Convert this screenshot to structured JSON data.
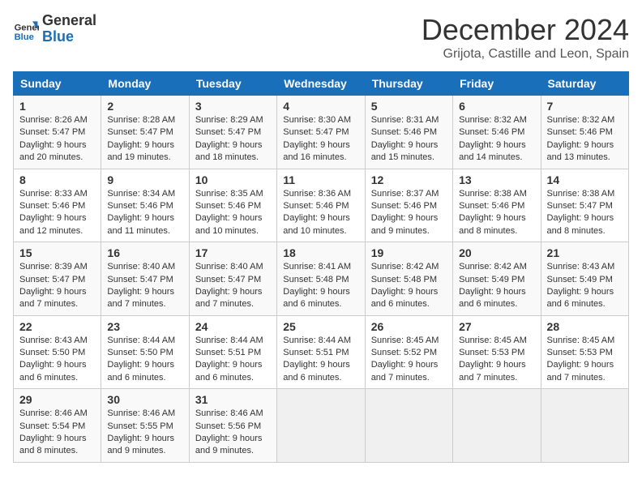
{
  "header": {
    "logo_general": "General",
    "logo_blue": "Blue",
    "month": "December 2024",
    "location": "Grijota, Castille and Leon, Spain"
  },
  "days_of_week": [
    "Sunday",
    "Monday",
    "Tuesday",
    "Wednesday",
    "Thursday",
    "Friday",
    "Saturday"
  ],
  "weeks": [
    [
      {
        "day": 1,
        "lines": [
          "Sunrise: 8:26 AM",
          "Sunset: 5:47 PM",
          "Daylight: 9 hours",
          "and 20 minutes."
        ]
      },
      {
        "day": 2,
        "lines": [
          "Sunrise: 8:28 AM",
          "Sunset: 5:47 PM",
          "Daylight: 9 hours",
          "and 19 minutes."
        ]
      },
      {
        "day": 3,
        "lines": [
          "Sunrise: 8:29 AM",
          "Sunset: 5:47 PM",
          "Daylight: 9 hours",
          "and 18 minutes."
        ]
      },
      {
        "day": 4,
        "lines": [
          "Sunrise: 8:30 AM",
          "Sunset: 5:47 PM",
          "Daylight: 9 hours",
          "and 16 minutes."
        ]
      },
      {
        "day": 5,
        "lines": [
          "Sunrise: 8:31 AM",
          "Sunset: 5:46 PM",
          "Daylight: 9 hours",
          "and 15 minutes."
        ]
      },
      {
        "day": 6,
        "lines": [
          "Sunrise: 8:32 AM",
          "Sunset: 5:46 PM",
          "Daylight: 9 hours",
          "and 14 minutes."
        ]
      },
      {
        "day": 7,
        "lines": [
          "Sunrise: 8:32 AM",
          "Sunset: 5:46 PM",
          "Daylight: 9 hours",
          "and 13 minutes."
        ]
      }
    ],
    [
      {
        "day": 8,
        "lines": [
          "Sunrise: 8:33 AM",
          "Sunset: 5:46 PM",
          "Daylight: 9 hours",
          "and 12 minutes."
        ]
      },
      {
        "day": 9,
        "lines": [
          "Sunrise: 8:34 AM",
          "Sunset: 5:46 PM",
          "Daylight: 9 hours",
          "and 11 minutes."
        ]
      },
      {
        "day": 10,
        "lines": [
          "Sunrise: 8:35 AM",
          "Sunset: 5:46 PM",
          "Daylight: 9 hours",
          "and 10 minutes."
        ]
      },
      {
        "day": 11,
        "lines": [
          "Sunrise: 8:36 AM",
          "Sunset: 5:46 PM",
          "Daylight: 9 hours",
          "and 10 minutes."
        ]
      },
      {
        "day": 12,
        "lines": [
          "Sunrise: 8:37 AM",
          "Sunset: 5:46 PM",
          "Daylight: 9 hours",
          "and 9 minutes."
        ]
      },
      {
        "day": 13,
        "lines": [
          "Sunrise: 8:38 AM",
          "Sunset: 5:46 PM",
          "Daylight: 9 hours",
          "and 8 minutes."
        ]
      },
      {
        "day": 14,
        "lines": [
          "Sunrise: 8:38 AM",
          "Sunset: 5:47 PM",
          "Daylight: 9 hours",
          "and 8 minutes."
        ]
      }
    ],
    [
      {
        "day": 15,
        "lines": [
          "Sunrise: 8:39 AM",
          "Sunset: 5:47 PM",
          "Daylight: 9 hours",
          "and 7 minutes."
        ]
      },
      {
        "day": 16,
        "lines": [
          "Sunrise: 8:40 AM",
          "Sunset: 5:47 PM",
          "Daylight: 9 hours",
          "and 7 minutes."
        ]
      },
      {
        "day": 17,
        "lines": [
          "Sunrise: 8:40 AM",
          "Sunset: 5:47 PM",
          "Daylight: 9 hours",
          "and 7 minutes."
        ]
      },
      {
        "day": 18,
        "lines": [
          "Sunrise: 8:41 AM",
          "Sunset: 5:48 PM",
          "Daylight: 9 hours",
          "and 6 minutes."
        ]
      },
      {
        "day": 19,
        "lines": [
          "Sunrise: 8:42 AM",
          "Sunset: 5:48 PM",
          "Daylight: 9 hours",
          "and 6 minutes."
        ]
      },
      {
        "day": 20,
        "lines": [
          "Sunrise: 8:42 AM",
          "Sunset: 5:49 PM",
          "Daylight: 9 hours",
          "and 6 minutes."
        ]
      },
      {
        "day": 21,
        "lines": [
          "Sunrise: 8:43 AM",
          "Sunset: 5:49 PM",
          "Daylight: 9 hours",
          "and 6 minutes."
        ]
      }
    ],
    [
      {
        "day": 22,
        "lines": [
          "Sunrise: 8:43 AM",
          "Sunset: 5:50 PM",
          "Daylight: 9 hours",
          "and 6 minutes."
        ]
      },
      {
        "day": 23,
        "lines": [
          "Sunrise: 8:44 AM",
          "Sunset: 5:50 PM",
          "Daylight: 9 hours",
          "and 6 minutes."
        ]
      },
      {
        "day": 24,
        "lines": [
          "Sunrise: 8:44 AM",
          "Sunset: 5:51 PM",
          "Daylight: 9 hours",
          "and 6 minutes."
        ]
      },
      {
        "day": 25,
        "lines": [
          "Sunrise: 8:44 AM",
          "Sunset: 5:51 PM",
          "Daylight: 9 hours",
          "and 6 minutes."
        ]
      },
      {
        "day": 26,
        "lines": [
          "Sunrise: 8:45 AM",
          "Sunset: 5:52 PM",
          "Daylight: 9 hours",
          "and 7 minutes."
        ]
      },
      {
        "day": 27,
        "lines": [
          "Sunrise: 8:45 AM",
          "Sunset: 5:53 PM",
          "Daylight: 9 hours",
          "and 7 minutes."
        ]
      },
      {
        "day": 28,
        "lines": [
          "Sunrise: 8:45 AM",
          "Sunset: 5:53 PM",
          "Daylight: 9 hours",
          "and 7 minutes."
        ]
      }
    ],
    [
      {
        "day": 29,
        "lines": [
          "Sunrise: 8:46 AM",
          "Sunset: 5:54 PM",
          "Daylight: 9 hours",
          "and 8 minutes."
        ]
      },
      {
        "day": 30,
        "lines": [
          "Sunrise: 8:46 AM",
          "Sunset: 5:55 PM",
          "Daylight: 9 hours",
          "and 9 minutes."
        ]
      },
      {
        "day": 31,
        "lines": [
          "Sunrise: 8:46 AM",
          "Sunset: 5:56 PM",
          "Daylight: 9 hours",
          "and 9 minutes."
        ]
      },
      null,
      null,
      null,
      null
    ]
  ]
}
